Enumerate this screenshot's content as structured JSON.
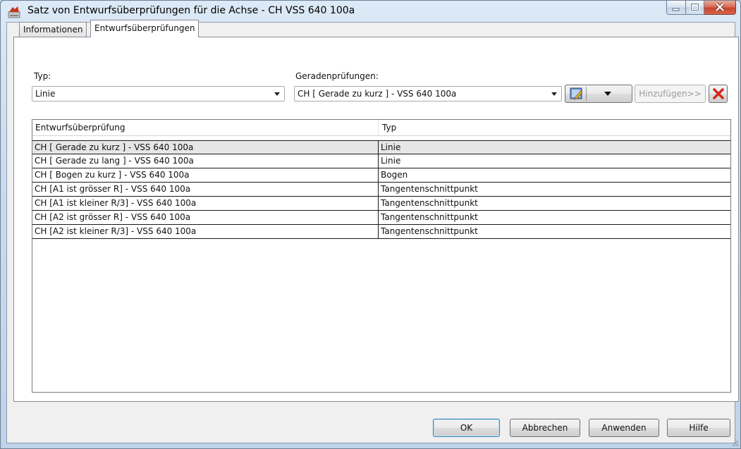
{
  "window": {
    "title": "Satz von Entwurfsüberprüfungen für die Achse - CH VSS 640 100a",
    "icons": [
      "app-icon",
      "minimize-icon",
      "maximize-icon",
      "close-icon"
    ]
  },
  "tabs": [
    {
      "label": "Informationen",
      "active": false
    },
    {
      "label": "Entwurfsüberprüfungen",
      "active": true
    }
  ],
  "form": {
    "type_label": "Typ:",
    "type_value": "Linie",
    "checks_label": "Geradenprüfungen:",
    "checks_value": "CH [ Gerade zu kurz ] - VSS 640 100a",
    "add_button": "Hinzufügen>>",
    "edit_icon": "edit-pencil-icon",
    "delete_icon": "delete-x-icon",
    "delete_color": "#d8261e"
  },
  "table": {
    "columns": [
      "Entwurfsüberprüfung",
      "Typ"
    ],
    "rows": [
      {
        "check": "CH [ Gerade zu kurz ] - VSS 640 100a",
        "type": "Linie"
      },
      {
        "check": "CH [ Gerade zu lang ] - VSS 640 100a",
        "type": "Linie"
      },
      {
        "check": "CH [ Bogen zu kurz ] - VSS 640 100a",
        "type": "Bogen"
      },
      {
        "check": "CH [A1 ist grösser R] - VSS 640 100a",
        "type": "Tangentenschnittpunkt"
      },
      {
        "check": "CH [A1 ist kleiner R/3] - VSS 640 100a",
        "type": "Tangentenschnittpunkt"
      },
      {
        "check": "CH [A2 ist grösser R] - VSS 640 100a",
        "type": "Tangentenschnittpunkt"
      },
      {
        "check": "CH [A2 ist kleiner R/3] - VSS 640 100a",
        "type": "Tangentenschnittpunkt"
      }
    ]
  },
  "footer": {
    "ok": "OK",
    "cancel": "Abbrechen",
    "apply": "Anwenden",
    "help": "Hilfe"
  }
}
